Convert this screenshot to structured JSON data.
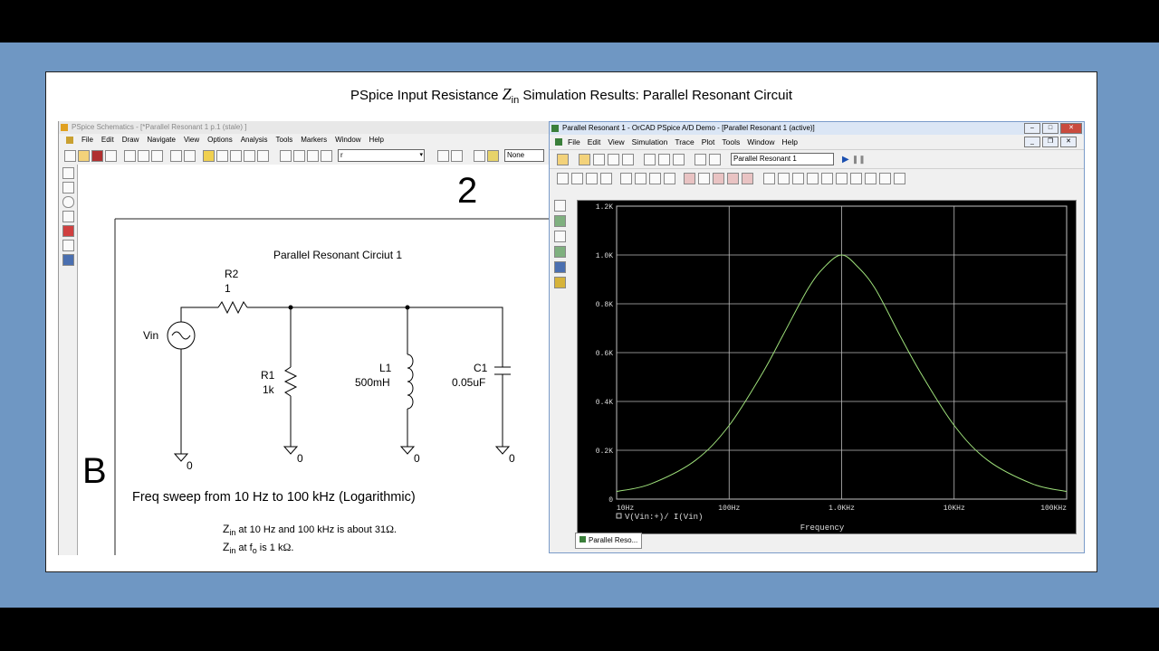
{
  "slide": {
    "title_pre": "PSpice Input Resistance ",
    "title_z": "Z",
    "title_sub": "in",
    "title_post": " Simulation Results: Parallel Resonant Circuit"
  },
  "schematics": {
    "title": "PSpice Schematics - [*Parallel Resonant 1  p.1 (stale) ]",
    "menu": [
      "File",
      "Edit",
      "Draw",
      "Navigate",
      "View",
      "Options",
      "Analysis",
      "Tools",
      "Markers",
      "Window",
      "Help"
    ],
    "part_combo": "r",
    "none_combo": "None",
    "page_number": "2",
    "border_letter": "B",
    "circuit_title": "Parallel Resonant Circiut 1",
    "components": {
      "r2_name": "R2",
      "r2_value": "1",
      "vin_name": "Vin",
      "r1_name": "R1",
      "r1_value": "1k",
      "l1_name": "L1",
      "l1_value": "500mH",
      "c1_name": "C1",
      "c1_value": "0.05uF",
      "gnd": "0"
    },
    "sweep_text": "Freq sweep from 10 Hz to 100 kHz (Logarithmic)",
    "note1_z": "Z",
    "note1_sub": "in",
    "note1_text": " at 10 Hz and 100 kHz is about 31",
    "note2_z": "Z",
    "note2_sub": "in",
    "note2_at": " at f",
    "note2_fsub": "o",
    "note2_text": " is 1 k",
    "ohm": "Ω."
  },
  "pspice": {
    "title": "Parallel Resonant 1 - OrCAD PSpice A/D Demo - [Parallel Resonant 1 (active)]",
    "menu": [
      "File",
      "Edit",
      "View",
      "Simulation",
      "Trace",
      "Plot",
      "Tools",
      "Window",
      "Help"
    ],
    "sim_combo": "Parallel Resonant 1",
    "tab_label": "Parallel Reso...",
    "trace_legend": "V(Vin:+)/ I(Vin)"
  },
  "chart_data": {
    "type": "line",
    "xscale": "log",
    "xlabel": "Frequency",
    "ylabel": "",
    "x_ticks": [
      "10Hz",
      "100Hz",
      "1.0KHz",
      "10KHz",
      "100KHz"
    ],
    "y_ticks": [
      "0",
      "0.2K",
      "0.4K",
      "0.6K",
      "0.8K",
      "1.0K",
      "1.2K"
    ],
    "xlim": [
      10,
      100000
    ],
    "ylim": [
      0,
      1200
    ],
    "grid": true,
    "series": [
      {
        "name": "V(Vin:+)/ I(Vin)",
        "color": "#9ee07a",
        "x": [
          10,
          20,
          50,
          100,
          200,
          300,
          500,
          700,
          1000,
          1400,
          2000,
          3300,
          5000,
          10000,
          20000,
          50000,
          100000
        ],
        "y": [
          31,
          62,
          158,
          302,
          520,
          670,
          860,
          950,
          1000,
          950,
          860,
          670,
          520,
          302,
          158,
          62,
          31
        ]
      }
    ]
  }
}
